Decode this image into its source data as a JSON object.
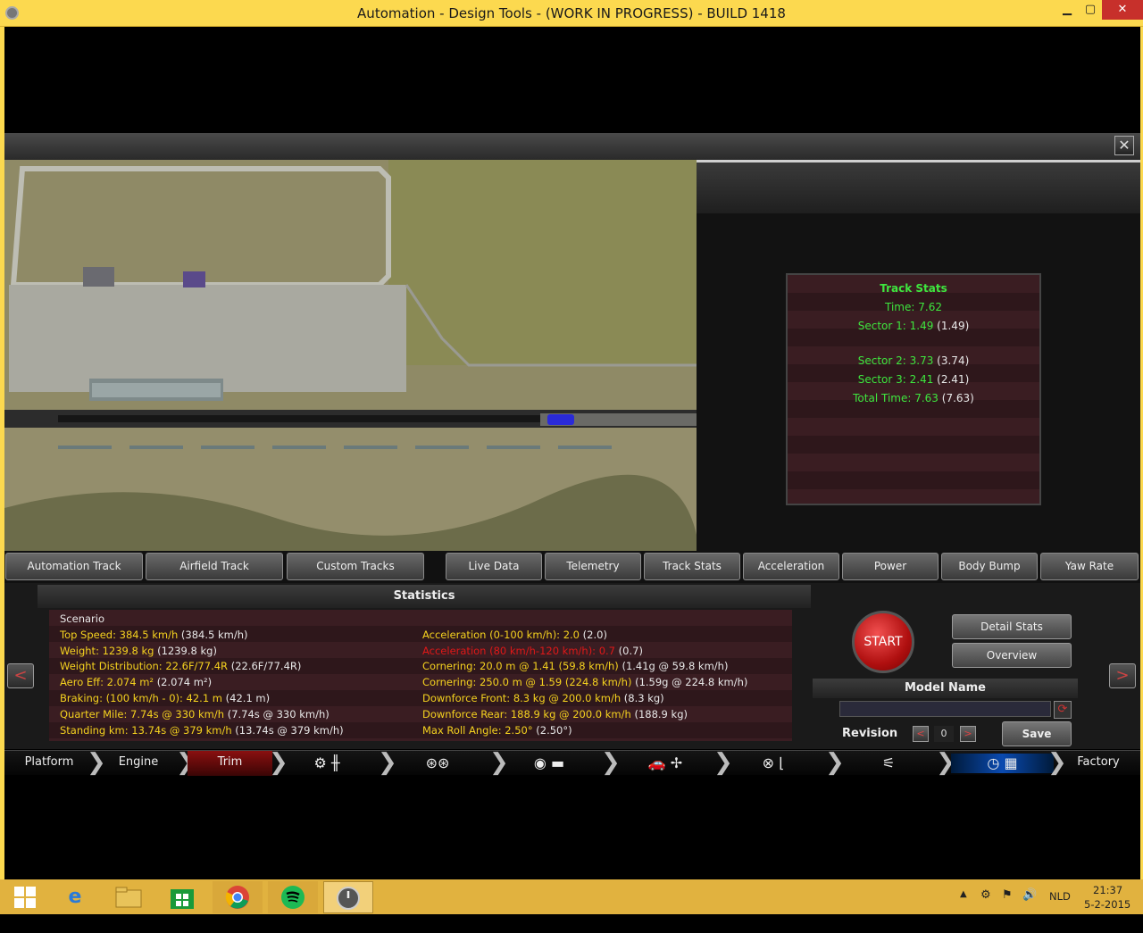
{
  "window": {
    "title": "Automation - Design Tools - (WORK IN PROGRESS) - BUILD 1418",
    "min": "▁",
    "max": "▢",
    "close": "✕"
  },
  "close_panel": "✕",
  "track_stats": {
    "title": "Track Stats",
    "time": "Time: 7.62",
    "sector1": "Sector 1: 1.49",
    "sector1_prev": "(1.49)",
    "sector2": "Sector 2: 3.73",
    "sector2_prev": "(3.74)",
    "sector3": "Sector 3: 2.41",
    "sector3_prev": "(2.41)",
    "total": "Total Time: 7.63",
    "total_prev": "(7.63)"
  },
  "track_tabs": [
    "Automation Track",
    "Airfield Track",
    "Custom Tracks"
  ],
  "data_tabs": [
    "Live Data",
    "Telemetry",
    "Track Stats",
    "Acceleration",
    "Power",
    "Body Bump",
    "Yaw Rate"
  ],
  "statistics": {
    "title": "Statistics",
    "scenario": "Scenario",
    "left": [
      {
        "label": "Top Speed: 384.5 km/h",
        "prev": "(384.5 km/h)"
      },
      {
        "label": "Weight: 1239.8 kg",
        "prev": "(1239.8 kg)"
      },
      {
        "label": "Weight Distribution: 22.6F/77.4R",
        "prev": "(22.6F/77.4R)"
      },
      {
        "label": "Aero Eff: 2.074 m²",
        "prev": "(2.074 m²)"
      },
      {
        "label": "Braking: (100 km/h - 0): 42.1 m",
        "prev": "(42.1 m)"
      },
      {
        "label": "Quarter Mile: 7.74s @ 330 km/h",
        "prev": "(7.74s @ 330 km/h)"
      },
      {
        "label": "Standing km: 13.74s @ 379 km/h",
        "prev": "(13.74s @ 379 km/h)"
      }
    ],
    "right": [
      {
        "label": "Acceleration (0-100 km/h): 2.0",
        "prev": "(2.0)"
      },
      {
        "label": "Acceleration (80 km/h-120 km/h): 0.7",
        "prev": "(0.7)"
      },
      {
        "label": "Cornering: 20.0 m @ 1.41 (59.8 km/h)",
        "prev": "(1.41g @ 59.8 km/h)"
      },
      {
        "label": "Cornering: 250.0 m @ 1.59 (224.8 km/h)",
        "prev": "(1.59g @ 224.8 km/h)"
      },
      {
        "label": "Downforce Front: 8.3 kg @ 200.0 km/h",
        "prev": "(8.3 kg)"
      },
      {
        "label": "Downforce Rear: 188.9 kg @ 200.0 km/h",
        "prev": "(188.9 kg)"
      },
      {
        "label": "Max Roll Angle: 2.50°",
        "prev": "(2.50°)"
      }
    ]
  },
  "controls": {
    "prev_arrow": "<",
    "next_arrow": ">",
    "start": "START",
    "detail_stats": "Detail Stats",
    "overview": "Overview",
    "model_name_label": "Model Name",
    "model_name_value": "",
    "revision_label": "Revision",
    "revision_value": "0",
    "rev_dec": "<",
    "rev_inc": ">",
    "save": "Save",
    "reload_icon": "⟳"
  },
  "nav": {
    "platform": "Platform",
    "engine": "Engine",
    "trim": "Trim",
    "factory": "Factory",
    "sep": "❯"
  },
  "taskbar": {
    "clock_time": "21:37",
    "clock_date": "5-2-2015",
    "lang": "NLD"
  },
  "colors": {
    "accent_green": "#3ee63e",
    "stat_yellow": "#f5d21f",
    "stat_red": "#e01818",
    "frame_yellow": "#fcd94f"
  }
}
